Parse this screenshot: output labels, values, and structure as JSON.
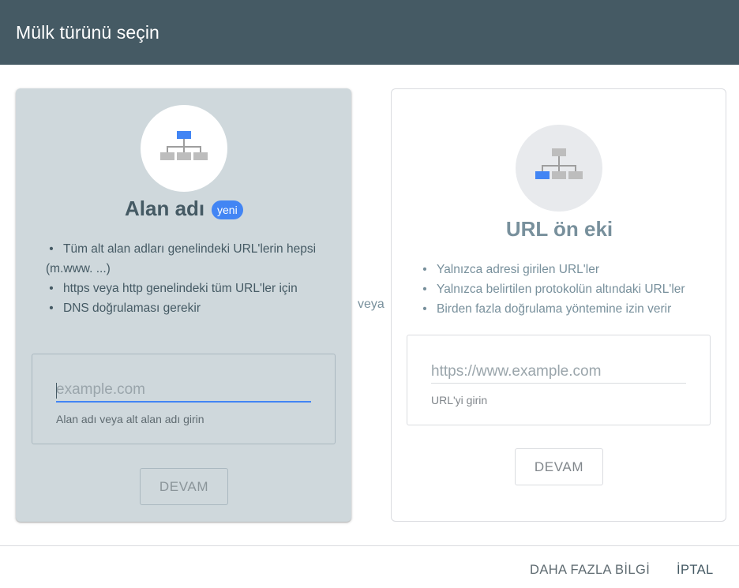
{
  "dialog": {
    "title": "Mülk türünü seçin"
  },
  "domain_card": {
    "title": "Alan adı",
    "badge": "yeni",
    "bullets": [
      "Tüm alt alan adları genelindeki URL'lerin hepsi (m.www. ...)",
      "https veya http genelindeki tüm URL'ler için",
      "DNS doğrulaması gerekir"
    ],
    "input_placeholder": "example.com",
    "input_value": "",
    "helper": "Alan adı veya alt alan adı girin",
    "button": "DEVAM",
    "icon": "sitemap-icon",
    "icon_highlight": "top"
  },
  "separator": "veya",
  "prefix_card": {
    "title": "URL ön eki",
    "bullets": [
      "Yalnızca adresi girilen URL'ler",
      "Yalnızca belirtilen protokolün altındaki URL'ler",
      "Birden fazla doğrulama yöntemine izin verir"
    ],
    "input_placeholder": "https://www.example.com",
    "input_value": "",
    "helper": "URL'yi girin",
    "button": "DEVAM",
    "icon": "sitemap-icon",
    "icon_highlight": "bottom-left"
  },
  "footer": {
    "learn_more": "DAHA FAZLA BİLGİ",
    "cancel": "İPTAL"
  },
  "colors": {
    "header": "#455a64",
    "accent": "#4285f4",
    "selected_card": "#cfd8dc"
  }
}
